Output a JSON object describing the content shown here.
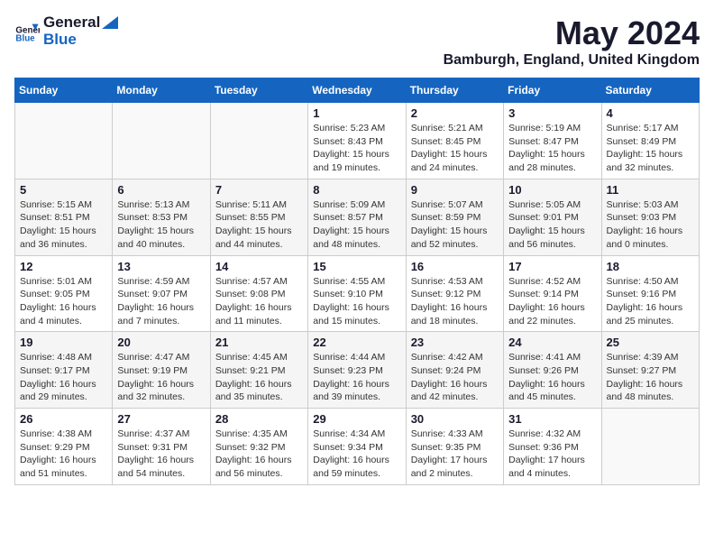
{
  "header": {
    "logo_general": "General",
    "logo_blue": "Blue",
    "month": "May 2024",
    "location": "Bamburgh, England, United Kingdom"
  },
  "weekdays": [
    "Sunday",
    "Monday",
    "Tuesday",
    "Wednesday",
    "Thursday",
    "Friday",
    "Saturday"
  ],
  "weeks": [
    [
      {
        "day": "",
        "info": ""
      },
      {
        "day": "",
        "info": ""
      },
      {
        "day": "",
        "info": ""
      },
      {
        "day": "1",
        "info": "Sunrise: 5:23 AM\nSunset: 8:43 PM\nDaylight: 15 hours\nand 19 minutes."
      },
      {
        "day": "2",
        "info": "Sunrise: 5:21 AM\nSunset: 8:45 PM\nDaylight: 15 hours\nand 24 minutes."
      },
      {
        "day": "3",
        "info": "Sunrise: 5:19 AM\nSunset: 8:47 PM\nDaylight: 15 hours\nand 28 minutes."
      },
      {
        "day": "4",
        "info": "Sunrise: 5:17 AM\nSunset: 8:49 PM\nDaylight: 15 hours\nand 32 minutes."
      }
    ],
    [
      {
        "day": "5",
        "info": "Sunrise: 5:15 AM\nSunset: 8:51 PM\nDaylight: 15 hours\nand 36 minutes."
      },
      {
        "day": "6",
        "info": "Sunrise: 5:13 AM\nSunset: 8:53 PM\nDaylight: 15 hours\nand 40 minutes."
      },
      {
        "day": "7",
        "info": "Sunrise: 5:11 AM\nSunset: 8:55 PM\nDaylight: 15 hours\nand 44 minutes."
      },
      {
        "day": "8",
        "info": "Sunrise: 5:09 AM\nSunset: 8:57 PM\nDaylight: 15 hours\nand 48 minutes."
      },
      {
        "day": "9",
        "info": "Sunrise: 5:07 AM\nSunset: 8:59 PM\nDaylight: 15 hours\nand 52 minutes."
      },
      {
        "day": "10",
        "info": "Sunrise: 5:05 AM\nSunset: 9:01 PM\nDaylight: 15 hours\nand 56 minutes."
      },
      {
        "day": "11",
        "info": "Sunrise: 5:03 AM\nSunset: 9:03 PM\nDaylight: 16 hours\nand 0 minutes."
      }
    ],
    [
      {
        "day": "12",
        "info": "Sunrise: 5:01 AM\nSunset: 9:05 PM\nDaylight: 16 hours\nand 4 minutes."
      },
      {
        "day": "13",
        "info": "Sunrise: 4:59 AM\nSunset: 9:07 PM\nDaylight: 16 hours\nand 7 minutes."
      },
      {
        "day": "14",
        "info": "Sunrise: 4:57 AM\nSunset: 9:08 PM\nDaylight: 16 hours\nand 11 minutes."
      },
      {
        "day": "15",
        "info": "Sunrise: 4:55 AM\nSunset: 9:10 PM\nDaylight: 16 hours\nand 15 minutes."
      },
      {
        "day": "16",
        "info": "Sunrise: 4:53 AM\nSunset: 9:12 PM\nDaylight: 16 hours\nand 18 minutes."
      },
      {
        "day": "17",
        "info": "Sunrise: 4:52 AM\nSunset: 9:14 PM\nDaylight: 16 hours\nand 22 minutes."
      },
      {
        "day": "18",
        "info": "Sunrise: 4:50 AM\nSunset: 9:16 PM\nDaylight: 16 hours\nand 25 minutes."
      }
    ],
    [
      {
        "day": "19",
        "info": "Sunrise: 4:48 AM\nSunset: 9:17 PM\nDaylight: 16 hours\nand 29 minutes."
      },
      {
        "day": "20",
        "info": "Sunrise: 4:47 AM\nSunset: 9:19 PM\nDaylight: 16 hours\nand 32 minutes."
      },
      {
        "day": "21",
        "info": "Sunrise: 4:45 AM\nSunset: 9:21 PM\nDaylight: 16 hours\nand 35 minutes."
      },
      {
        "day": "22",
        "info": "Sunrise: 4:44 AM\nSunset: 9:23 PM\nDaylight: 16 hours\nand 39 minutes."
      },
      {
        "day": "23",
        "info": "Sunrise: 4:42 AM\nSunset: 9:24 PM\nDaylight: 16 hours\nand 42 minutes."
      },
      {
        "day": "24",
        "info": "Sunrise: 4:41 AM\nSunset: 9:26 PM\nDaylight: 16 hours\nand 45 minutes."
      },
      {
        "day": "25",
        "info": "Sunrise: 4:39 AM\nSunset: 9:27 PM\nDaylight: 16 hours\nand 48 minutes."
      }
    ],
    [
      {
        "day": "26",
        "info": "Sunrise: 4:38 AM\nSunset: 9:29 PM\nDaylight: 16 hours\nand 51 minutes."
      },
      {
        "day": "27",
        "info": "Sunrise: 4:37 AM\nSunset: 9:31 PM\nDaylight: 16 hours\nand 54 minutes."
      },
      {
        "day": "28",
        "info": "Sunrise: 4:35 AM\nSunset: 9:32 PM\nDaylight: 16 hours\nand 56 minutes."
      },
      {
        "day": "29",
        "info": "Sunrise: 4:34 AM\nSunset: 9:34 PM\nDaylight: 16 hours\nand 59 minutes."
      },
      {
        "day": "30",
        "info": "Sunrise: 4:33 AM\nSunset: 9:35 PM\nDaylight: 17 hours\nand 2 minutes."
      },
      {
        "day": "31",
        "info": "Sunrise: 4:32 AM\nSunset: 9:36 PM\nDaylight: 17 hours\nand 4 minutes."
      },
      {
        "day": "",
        "info": ""
      }
    ]
  ]
}
